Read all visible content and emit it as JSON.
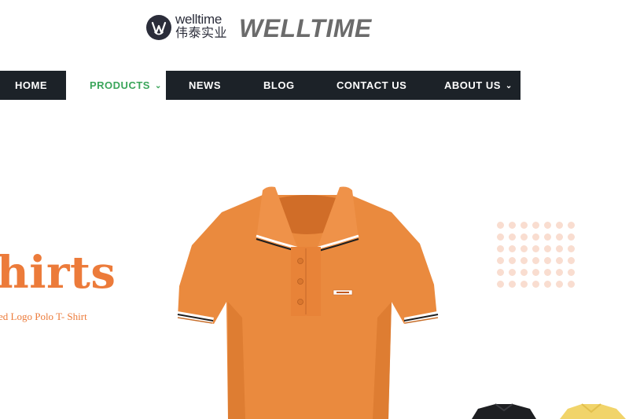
{
  "brand": {
    "logo_en": "welltime",
    "logo_cn": "伟泰实业",
    "wordmark": "WELLTIME"
  },
  "nav": {
    "items": [
      {
        "label": "HOME",
        "active": false,
        "has_dropdown": false
      },
      {
        "label": "PRODUCTS",
        "active": true,
        "has_dropdown": true
      },
      {
        "label": "NEWS",
        "active": false,
        "has_dropdown": false
      },
      {
        "label": "BLOG",
        "active": false,
        "has_dropdown": false
      },
      {
        "label": "CONTACT US",
        "active": false,
        "has_dropdown": false
      },
      {
        "label": "ABOUT US",
        "active": false,
        "has_dropdown": true
      }
    ],
    "chevron": "⌄"
  },
  "hero": {
    "title": "hirts",
    "subtitle": "ed Logo Polo T- Shirt"
  },
  "colors": {
    "nav_bg": "#1c2228",
    "nav_active": "#3aa55a",
    "accent_orange": "#ec7b3a",
    "logo_dark": "#2b2d3a",
    "wordmark_gray": "#6b6b6b"
  },
  "icons": {
    "logo": "welltime-w-logo-icon",
    "dropdown": "chevron-down-icon"
  }
}
